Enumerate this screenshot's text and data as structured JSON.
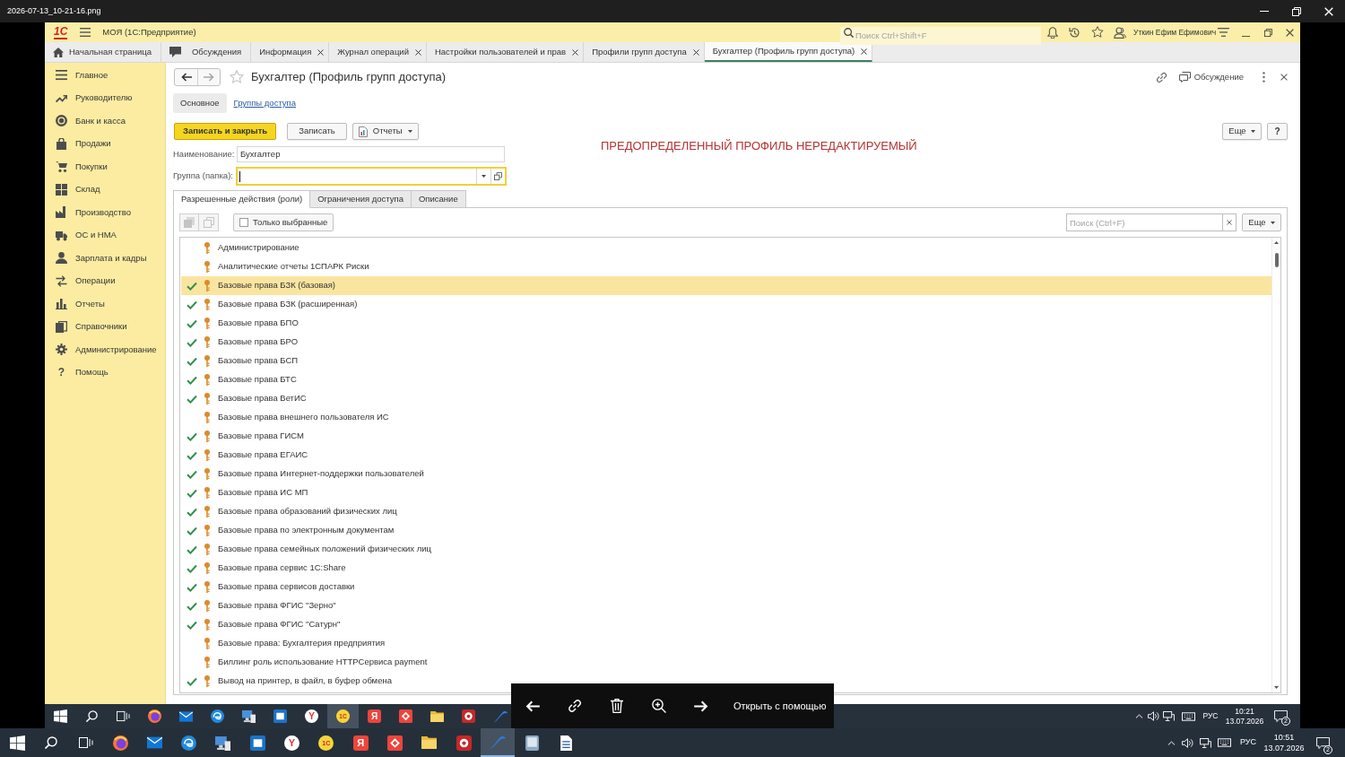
{
  "viewer": {
    "title": "2026-07-13_10-21-16.png",
    "toolbar": {
      "open_with": "Открыть с помощью"
    }
  },
  "app": {
    "logo": "1С",
    "title": "МОЯ (1С:Предприятие)",
    "search": {
      "placeholder": "Поиск Ctrl+Shift+F"
    },
    "user": "Уткин Ефим Ефимович",
    "tabs": [
      {
        "label": "Начальная страница",
        "kind": "home",
        "closable": false,
        "selected": false
      },
      {
        "label": "Обсуждения",
        "kind": "discussions",
        "closable": false,
        "selected": false
      },
      {
        "label": "Информация",
        "kind": "page",
        "closable": true,
        "selected": false
      },
      {
        "label": "Журнал операций",
        "kind": "page",
        "closable": true,
        "selected": false
      },
      {
        "label": "Настройки пользователей и прав",
        "kind": "page",
        "closable": true,
        "selected": false
      },
      {
        "label": "Профили групп доступа",
        "kind": "page",
        "closable": true,
        "selected": false
      },
      {
        "label": "Бухгалтер (Профиль групп доступа)",
        "kind": "page",
        "closable": true,
        "selected": true
      }
    ],
    "sidebar": {
      "items": [
        {
          "label": "Главное",
          "kind": "main"
        },
        {
          "label": "Руководителю",
          "kind": "trend"
        },
        {
          "label": "Банк и касса",
          "kind": "bank"
        },
        {
          "label": "Продажи",
          "kind": "sales"
        },
        {
          "label": "Покупки",
          "kind": "purchases"
        },
        {
          "label": "Склад",
          "kind": "warehouse"
        },
        {
          "label": "Производство",
          "kind": "production"
        },
        {
          "label": "ОС и НМА",
          "kind": "assets"
        },
        {
          "label": "Зарплата и кадры",
          "kind": "salary"
        },
        {
          "label": "Операции",
          "kind": "operations"
        },
        {
          "label": "Отчеты",
          "kind": "reports"
        },
        {
          "label": "Справочники",
          "kind": "catalogs"
        },
        {
          "label": "Администрирование",
          "kind": "admin"
        },
        {
          "label": "Помощь",
          "kind": "help",
          "glyph": "?"
        }
      ]
    },
    "form": {
      "navigation": [
        {
          "kind": "back",
          "disabled": false
        },
        {
          "kind": "forward",
          "disabled": true
        }
      ],
      "favorite": false,
      "title": "Бухгалтер (Профиль групп доступа)",
      "discussion": "Обсуждение",
      "sections": [
        {
          "label": "Основное",
          "selected": true
        },
        {
          "label": "Группы доступа",
          "selected": false
        }
      ],
      "commands": [
        {
          "label": "Записать и закрыть",
          "kind": "primary"
        },
        {
          "label": "Записать",
          "kind": "plain"
        },
        {
          "label": "Отчеты",
          "kind": "menu"
        }
      ],
      "more": "Еще",
      "help": "?",
      "notice": "ПРЕДОПРЕДЕЛЕННЫЙ ПРОФИЛЬ НЕРЕДАКТИРУЕМЫЙ",
      "fields": [
        {
          "label": "Наименование:",
          "kind": "text",
          "value": "Бухгалтер",
          "focused": false
        },
        {
          "label": "Группа (папка):",
          "kind": "choice",
          "focused": true
        }
      ],
      "tabs": [
        {
          "label": "Разрешенные действия (роли)",
          "selected": true
        },
        {
          "label": "Ограничения доступа",
          "selected": false
        },
        {
          "label": "Описание",
          "selected": false
        }
      ],
      "roles": {
        "buttons": [
          {
            "kind": "check-all",
            "disabled": true
          },
          {
            "kind": "uncheck-all",
            "disabled": true
          }
        ],
        "filter": {
          "label": "Только выбранные",
          "checked": false
        },
        "search": {
          "placeholder": "Поиск (Ctrl+F)"
        },
        "more": "Еще",
        "rows": [
          {
            "name": "Администрирование",
            "checked": false,
            "selected": false
          },
          {
            "name": "Аналитические отчеты 1СПАРК Риски",
            "checked": false,
            "selected": false
          },
          {
            "name": "Базовые права БЗК (базовая)",
            "checked": true,
            "selected": true
          },
          {
            "name": "Базовые права БЗК (расширенная)",
            "checked": true,
            "selected": false
          },
          {
            "name": "Базовые права БПО",
            "checked": true,
            "selected": false
          },
          {
            "name": "Базовые права БРО",
            "checked": true,
            "selected": false
          },
          {
            "name": "Базовые права БСП",
            "checked": true,
            "selected": false
          },
          {
            "name": "Базовые права БТС",
            "checked": true,
            "selected": false
          },
          {
            "name": "Базовые права ВетИС",
            "checked": true,
            "selected": false
          },
          {
            "name": "Базовые права внешнего пользователя ИС",
            "checked": false,
            "selected": false
          },
          {
            "name": "Базовые права ГИСМ",
            "checked": true,
            "selected": false
          },
          {
            "name": "Базовые права ЕГАИС",
            "checked": true,
            "selected": false
          },
          {
            "name": "Базовые права Интернет-поддержки пользователей",
            "checked": true,
            "selected": false
          },
          {
            "name": "Базовые права ИС МП",
            "checked": true,
            "selected": false
          },
          {
            "name": "Базовые права образований физических лиц",
            "checked": true,
            "selected": false
          },
          {
            "name": "Базовые права по электронным документам",
            "checked": true,
            "selected": false
          },
          {
            "name": "Базовые права семейных положений физических лиц",
            "checked": true,
            "selected": false
          },
          {
            "name": "Базовые права сервис 1С:Share",
            "checked": true,
            "selected": false
          },
          {
            "name": "Базовые права сервисов доставки",
            "checked": true,
            "selected": false
          },
          {
            "name": "Базовые права ФГИС \"Зерно\"",
            "checked": true,
            "selected": false
          },
          {
            "name": "Базовые права ФГИС \"Сатурн\"",
            "checked": true,
            "selected": false
          },
          {
            "name": "Базовые права: Бухгалтерия предприятия",
            "checked": false,
            "selected": false
          },
          {
            "name": "Биллинг роль использование HTTPСервиса payment",
            "checked": false,
            "selected": false
          },
          {
            "name": "Вывод на принтер, в файл, в буфер обмена",
            "checked": true,
            "selected": false
          }
        ]
      }
    }
  },
  "screen_taskbar": {
    "apps": [
      {
        "kind": "start",
        "active": false
      },
      {
        "kind": "search",
        "active": false
      },
      {
        "kind": "task-view",
        "active": false
      },
      {
        "kind": "globe",
        "active": false
      },
      {
        "kind": "mail",
        "active": false
      },
      {
        "kind": "swirl",
        "active": false
      },
      {
        "kind": "monitor",
        "active": false
      },
      {
        "kind": "window",
        "active": false
      },
      {
        "kind": "letter-circle",
        "glyph": "Y",
        "active": false
      },
      {
        "kind": "letter-coin",
        "glyph": "1С",
        "active": true
      },
      {
        "kind": "letter-tile",
        "glyph": "Я",
        "active": false
      },
      {
        "kind": "diamond",
        "active": false
      },
      {
        "kind": "folder",
        "active": false
      },
      {
        "kind": "circle-tile",
        "active": false
      },
      {
        "kind": "swoosh",
        "active": false
      }
    ],
    "language": "РУС",
    "time": "10:21",
    "date": "13.07.2026",
    "notifications": "2"
  },
  "taskbar": {
    "apps": [
      {
        "kind": "start",
        "active": false
      },
      {
        "kind": "search",
        "active": false
      },
      {
        "kind": "task-view",
        "active": false
      },
      {
        "kind": "globe",
        "active": false
      },
      {
        "kind": "mail",
        "active": false
      },
      {
        "kind": "swirl",
        "active": false
      },
      {
        "kind": "monitor",
        "active": false
      },
      {
        "kind": "window",
        "active": false
      },
      {
        "kind": "letter-circle",
        "glyph": "Y",
        "active": false
      },
      {
        "kind": "letter-coin",
        "glyph": "1С",
        "active": false
      },
      {
        "kind": "letter-tile",
        "glyph": "Я",
        "active": false
      },
      {
        "kind": "diamond",
        "active": false
      },
      {
        "kind": "folder",
        "active": false
      },
      {
        "kind": "circle-tile",
        "active": false
      },
      {
        "kind": "swoosh",
        "active": true
      },
      {
        "kind": "tablet",
        "active": false
      },
      {
        "kind": "document",
        "active": false
      }
    ],
    "language": "РУС",
    "time": "10:51",
    "date": "13.07.2026",
    "notifications": "2"
  }
}
